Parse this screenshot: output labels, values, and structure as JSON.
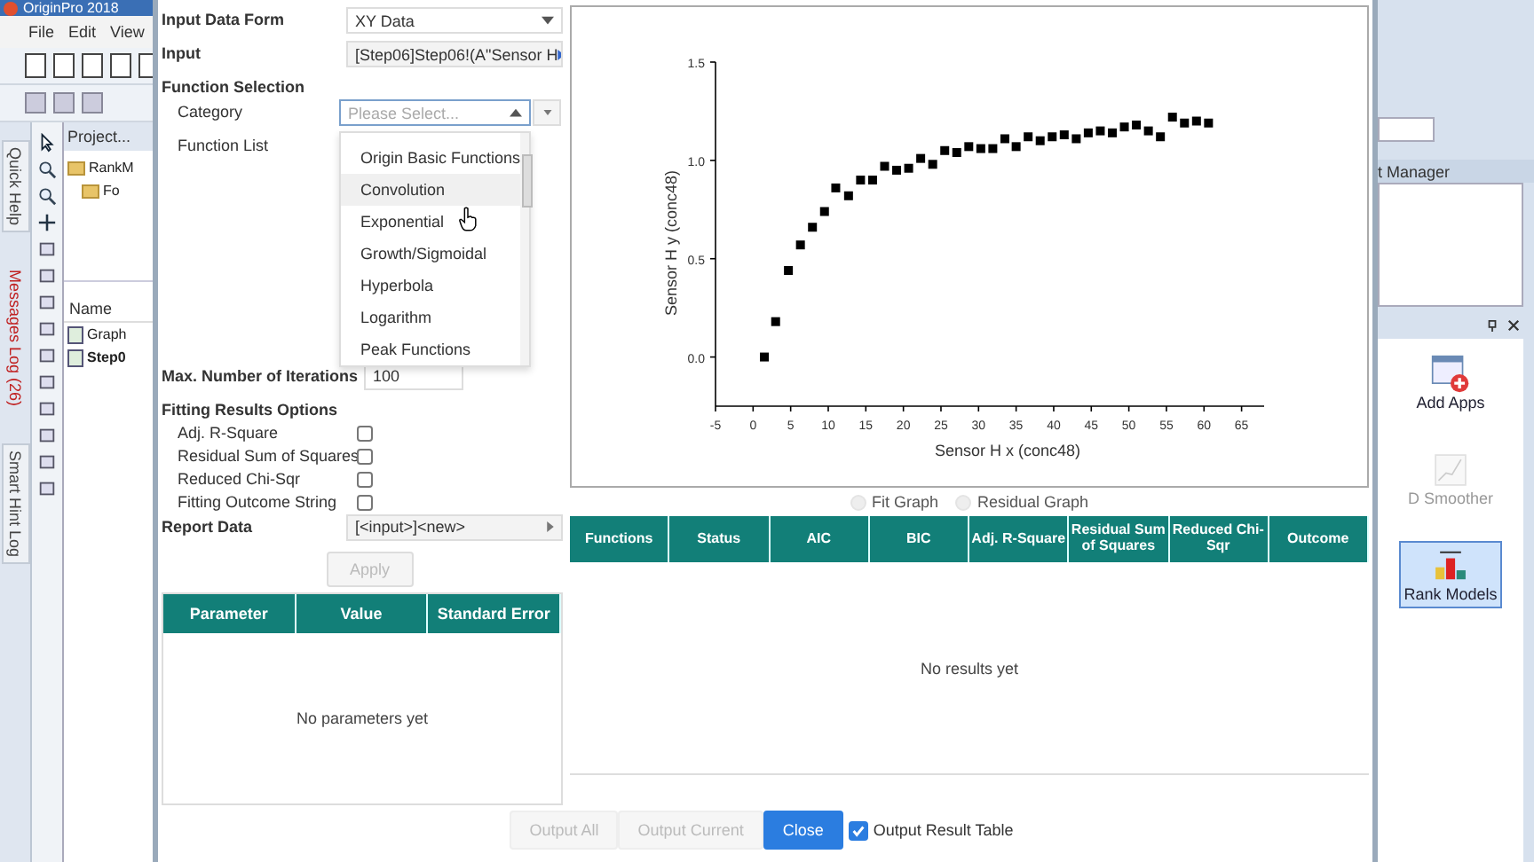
{
  "app": {
    "title": "OriginPro 2018",
    "menu": [
      "File",
      "Edit",
      "View"
    ],
    "side_tabs": [
      {
        "label": "Quick Help",
        "alert": false
      },
      {
        "label": "Messages Log (26)",
        "alert": true
      },
      {
        "label": "Smart Hint Log",
        "alert": false
      }
    ],
    "project": {
      "header": "Project...",
      "tree": [
        {
          "label": "RankM",
          "children": [
            {
              "label": "Fo"
            }
          ]
        }
      ],
      "name_header": "Name",
      "files": [
        {
          "label": "Graph",
          "bold": false
        },
        {
          "label": "Step0",
          "bold": true
        }
      ]
    },
    "right_panel": {
      "manager_title": "t Manager",
      "apps": [
        {
          "label": "Add Apps",
          "kind": "add",
          "selected": false,
          "disabled": false
        },
        {
          "label": "D Smoother",
          "kind": "smoother",
          "selected": false,
          "disabled": true
        },
        {
          "label": "Rank Models",
          "kind": "rank",
          "selected": true,
          "disabled": false
        }
      ]
    }
  },
  "dialog": {
    "input_data_form": {
      "label": "Input Data Form",
      "value": "XY Data"
    },
    "input": {
      "label": "Input",
      "value": "[Step06]Step06!(A\"Sensor H"
    },
    "function_selection": {
      "heading": "Function Selection",
      "category_label": "Category",
      "category_placeholder": "Please Select...",
      "function_list_label": "Function List",
      "options": [
        {
          "label": "Origin Basic Functions",
          "highlighted": false
        },
        {
          "label": "Convolution",
          "highlighted": true
        },
        {
          "label": "Exponential",
          "highlighted": false
        },
        {
          "label": "Growth/Sigmoidal",
          "highlighted": false
        },
        {
          "label": "Hyperbola",
          "highlighted": false
        },
        {
          "label": "Logarithm",
          "highlighted": false
        },
        {
          "label": "Peak Functions",
          "highlighted": false
        }
      ]
    },
    "max_iterations": {
      "label": "Max. Number of Iterations",
      "value": "100"
    },
    "fitting_options": {
      "heading": "Fitting Results Options",
      "items": [
        {
          "label": "Adj. R-Square",
          "checked": false
        },
        {
          "label": "Residual Sum of Squares",
          "checked": false
        },
        {
          "label": "Reduced Chi-Sqr",
          "checked": false
        },
        {
          "label": "Fitting Outcome String",
          "checked": false
        }
      ]
    },
    "report_data": {
      "label": "Report Data",
      "value": "[<input>]<new>"
    },
    "apply_button": {
      "label": "Apply",
      "disabled": true
    },
    "parameters_table": {
      "columns": [
        "Parameter",
        "Value",
        "Standard Error"
      ],
      "empty_text": "No parameters yet"
    },
    "chart": {
      "chart_data": {
        "type": "scatter",
        "xlabel": "Sensor H x (conc48)",
        "ylabel": "Sensor H y (conc48)",
        "x": [
          1.5,
          3,
          4.7,
          6.3,
          7.9,
          9.5,
          11,
          12.7,
          14.3,
          15.9,
          17.5,
          19.1,
          20.7,
          22.3,
          23.9,
          25.5,
          27.1,
          28.7,
          30.3,
          31.9,
          33.5,
          35,
          36.6,
          38.2,
          39.8,
          41.4,
          43,
          44.6,
          46.2,
          47.8,
          49.4,
          51,
          52.6,
          54.2,
          55.8,
          57.4,
          59,
          60.6
        ],
        "series": [
          {
            "color": "#000000",
            "values": [
              0.0,
              0.18,
              0.44,
              0.57,
              0.66,
              0.74,
              0.86,
              0.82,
              0.9,
              0.9,
              0.97,
              0.95,
              0.96,
              1.01,
              0.98,
              1.05,
              1.04,
              1.07,
              1.06,
              1.06,
              1.11,
              1.07,
              1.12,
              1.1,
              1.12,
              1.13,
              1.11,
              1.14,
              1.15,
              1.14,
              1.17,
              1.18,
              1.15,
              1.12,
              1.22,
              1.19,
              1.2,
              1.19
            ]
          }
        ],
        "xlim": [
          -5,
          68
        ],
        "ylim": [
          -0.25,
          1.5
        ],
        "xticks": [
          -5,
          0,
          5,
          10,
          15,
          20,
          25,
          30,
          35,
          40,
          45,
          50,
          55,
          60,
          65
        ],
        "yticks": [
          {
            "value": 0,
            "label": "0.0"
          },
          {
            "value": 0.5,
            "label": "0.5"
          },
          {
            "value": 1,
            "label": "1.0"
          },
          {
            "value": 1.5,
            "label": "1.5"
          }
        ]
      }
    },
    "graph_options": [
      {
        "label": "Fit Graph",
        "selected": false
      },
      {
        "label": "Residual Graph",
        "selected": false
      }
    ],
    "results_table": {
      "columns": [
        "Functions",
        "Status",
        "AIC",
        "BIC",
        "Adj. R-Square",
        "Residual Sum of Squares",
        "Reduced Chi-Sqr",
        "Outcome"
      ],
      "empty_text": "No results yet"
    },
    "buttons": [
      {
        "label": "Output All",
        "disabled": true,
        "primary": false
      },
      {
        "label": "Output Current",
        "disabled": true,
        "primary": false
      },
      {
        "label": "Close",
        "disabled": false,
        "primary": true
      }
    ],
    "output_result_table": {
      "label": "Output Result Table",
      "checked": true
    }
  }
}
